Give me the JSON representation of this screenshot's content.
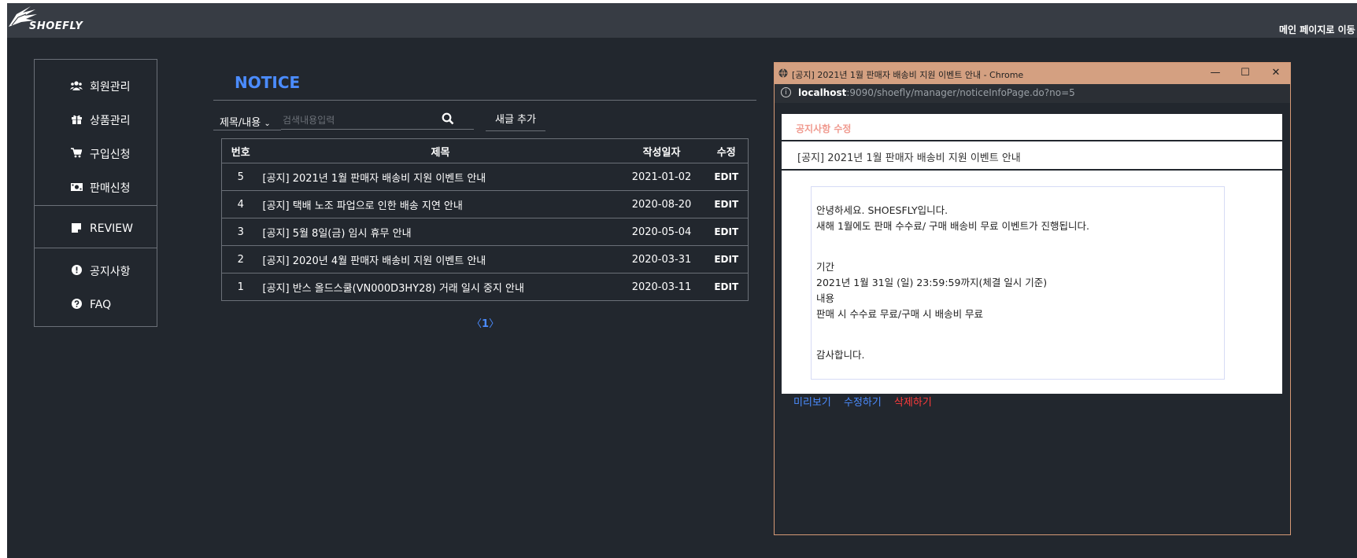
{
  "header": {
    "logo_text": "SHOEFLY",
    "main_link": "메인 페이지로 이동"
  },
  "sidebar": {
    "items": [
      {
        "label": "회원관리",
        "icon": "users-icon"
      },
      {
        "label": "상품관리",
        "icon": "gift-icon"
      },
      {
        "label": "구입신청",
        "icon": "cart-icon"
      },
      {
        "label": "판매신청",
        "icon": "money-icon"
      },
      {
        "label": "REVIEW",
        "icon": "sticky-note-icon"
      },
      {
        "label": "공지사항",
        "icon": "exclamation-icon"
      },
      {
        "label": "FAQ",
        "icon": "question-icon"
      }
    ]
  },
  "main": {
    "title": "NOTICE",
    "search": {
      "select_value": "제목/내용",
      "placeholder": "검색내용입력"
    },
    "add_button": "새글 추가",
    "table": {
      "headers": [
        "번호",
        "제목",
        "작성일자",
        "수정"
      ],
      "rows": [
        {
          "no": "5",
          "title": "[공지] 2021년 1월 판매자 배송비 지원 이벤트 안내",
          "date": "2021-01-02",
          "edit": "EDIT"
        },
        {
          "no": "4",
          "title": "[공지] 택배 노조 파업으로 인한 배송 지연 안내",
          "date": "2020-08-20",
          "edit": "EDIT"
        },
        {
          "no": "3",
          "title": "[공지] 5월 8일(금) 임시 휴무 안내",
          "date": "2020-05-04",
          "edit": "EDIT"
        },
        {
          "no": "2",
          "title": "[공지] 2020년 4월 판매자 배송비 지원 이벤트 안내",
          "date": "2020-03-31",
          "edit": "EDIT"
        },
        {
          "no": "1",
          "title": "[공지] 반스 올드스쿨(VN000D3HY28) 거래 일시 중지 안내",
          "date": "2020-03-11",
          "edit": "EDIT"
        }
      ]
    },
    "pager": {
      "prev": "〈",
      "current": "1",
      "next": "〉"
    }
  },
  "popup": {
    "window_title": "[공지] 2021년 1월 판매자 배송비 지원 이벤트 안내 - Chrome",
    "url_host": "localhost",
    "url_path": ":9090/shoefly/manager/noticeInfoPage.do?no=5",
    "edit_heading": "공지사항 수정",
    "title_value": "[공지] 2021년 1월 판매자 배송비 지원 이벤트 안내",
    "body_lines": [
      "안녕하세요. SHOESFLY입니다.",
      "새해 1월에도 판매 수수료/ 구매 배송비 무료 이벤트가 진행됩니다.",
      "기간",
      "2021년 1월 31일 (일) 23:59:59까지(체결 일시 기준)",
      "내용",
      "판매 시 수수료 무료/구매 시 배송비 무료",
      "감사합니다."
    ],
    "actions": {
      "preview": "미리보기",
      "save": "수정하기",
      "delete": "삭제하기"
    }
  },
  "colors": {
    "background": "#22272e",
    "topbar": "#373c44",
    "accent": "#4b8cff",
    "danger": "#ff3b3b",
    "popup_titlebar": "#d4a081",
    "edit_heading": "#f09a8f"
  }
}
